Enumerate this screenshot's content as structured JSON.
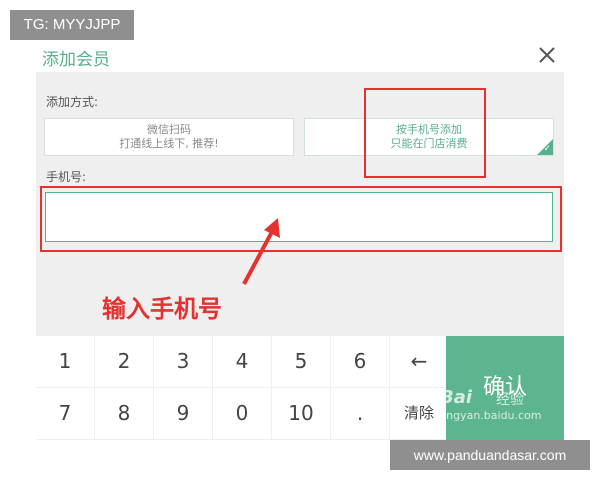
{
  "watermarks": {
    "top_left": "TG: MYYJJPP",
    "bottom_right": "www.panduandasar.com",
    "baidu_brand": "Bai",
    "baidu_sub": "经验",
    "baidu_url": "jingyan.baidu.com"
  },
  "dialog": {
    "title": "添加会员",
    "close_icon": "close-icon",
    "method_label": "添加方式:",
    "methods": [
      {
        "line1": "微信扫码",
        "line2": "打通线上线下, 推荐!",
        "selected": false
      },
      {
        "line1": "按手机号添加",
        "line2": "只能在门店消费",
        "selected": true
      }
    ],
    "phone_label": "手机号:",
    "phone_value": "",
    "phone_placeholder": ""
  },
  "annotation": {
    "text": "输入手机号",
    "color": "#e5312f"
  },
  "keypad": {
    "rows": [
      [
        "1",
        "2",
        "3",
        "4",
        "5",
        "6",
        "←"
      ],
      [
        "7",
        "8",
        "9",
        "0",
        "10",
        ".",
        "清除"
      ]
    ],
    "confirm": "确认"
  },
  "colors": {
    "accent": "#58b08c",
    "confirm_bg": "#5db58f",
    "annotation_red": "#e5312f"
  }
}
